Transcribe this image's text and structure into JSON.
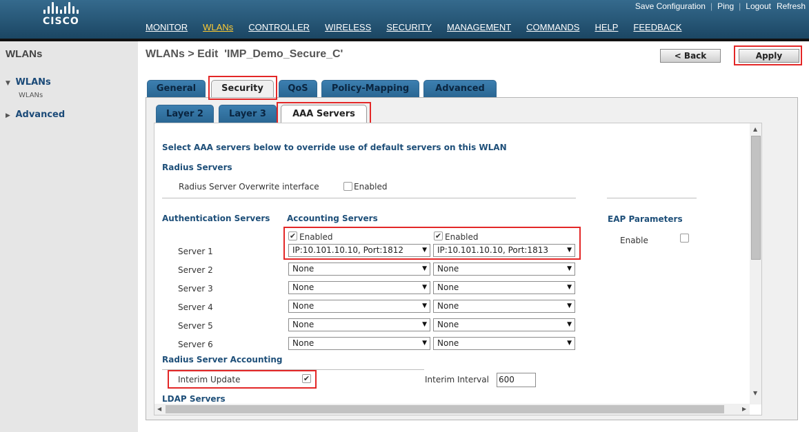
{
  "brand": {
    "name": "CISCO"
  },
  "utility_links": [
    {
      "name": "save-configuration-link",
      "label": "Save Configuration"
    },
    {
      "name": "ping-link",
      "label": "Ping"
    },
    {
      "name": "logout-link",
      "label": "Logout"
    },
    {
      "name": "refresh-link",
      "label": "Refresh"
    }
  ],
  "nav": [
    {
      "name": "nav-monitor",
      "label": "MONITOR"
    },
    {
      "name": "nav-wlans",
      "label": "WLANs",
      "active": true
    },
    {
      "name": "nav-controller",
      "label": "CONTROLLER"
    },
    {
      "name": "nav-wireless",
      "label": "WIRELESS"
    },
    {
      "name": "nav-security",
      "label": "SECURITY"
    },
    {
      "name": "nav-management",
      "label": "MANAGEMENT"
    },
    {
      "name": "nav-commands",
      "label": "COMMANDS"
    },
    {
      "name": "nav-help",
      "label": "HELP"
    },
    {
      "name": "nav-feedback",
      "label": "FEEDBACK"
    }
  ],
  "sidebar": {
    "title": "WLANs",
    "items": [
      {
        "label": "WLANs",
        "expanded": true,
        "icon": "triangle-down-icon",
        "children": [
          "WLANs"
        ]
      },
      {
        "label": "Advanced",
        "expanded": false,
        "icon": "triangle-right-icon"
      }
    ]
  },
  "page": {
    "title": "WLANs > Edit  'IMP_Demo_Secure_C'",
    "back_label": "< Back",
    "apply_label": "Apply"
  },
  "tabs": [
    {
      "label": "General"
    },
    {
      "label": "Security",
      "selected": true
    },
    {
      "label": "QoS"
    },
    {
      "label": "Policy-Mapping"
    },
    {
      "label": "Advanced"
    }
  ],
  "subtabs": [
    {
      "label": "Layer 2"
    },
    {
      "label": "Layer 3"
    },
    {
      "label": "AAA Servers",
      "selected": true
    }
  ],
  "aaa": {
    "intro": "Select AAA servers below to override use of default servers on this WLAN",
    "radius_heading": "Radius Servers",
    "overwrite_label": "Radius Server Overwrite interface",
    "overwrite_enabled_label": "Enabled",
    "overwrite_checked": false,
    "auth_heading": "Authentication Servers",
    "acct_heading": "Accounting Servers",
    "eap_heading": "EAP Parameters",
    "eap_enable_label": "Enable",
    "eap_checked": false,
    "auth_enabled_label": "Enabled",
    "auth_enabled_checked": true,
    "acct_enabled_label": "Enabled",
    "acct_enabled_checked": true,
    "servers": [
      {
        "label": "Server 1",
        "auth": "IP:10.101.10.10, Port:1812",
        "acct": "IP:10.101.10.10, Port:1813"
      },
      {
        "label": "Server 2",
        "auth": "None",
        "acct": "None"
      },
      {
        "label": "Server 3",
        "auth": "None",
        "acct": "None"
      },
      {
        "label": "Server 4",
        "auth": "None",
        "acct": "None"
      },
      {
        "label": "Server 5",
        "auth": "None",
        "acct": "None"
      },
      {
        "label": "Server 6",
        "auth": "None",
        "acct": "None"
      }
    ],
    "accounting_heading": "Radius Server Accounting",
    "interim_update_label": "Interim Update",
    "interim_update_checked": true,
    "interim_interval_label": "Interim Interval",
    "interim_interval_value": "600",
    "ldap_heading": "LDAP Servers"
  },
  "colors": {
    "header_blue": "#2a5a7c",
    "tab_blue": "#3575a4",
    "heading_blue": "#1e4f79",
    "highlight_red": "#e32626",
    "active_nav": "#ffcc33"
  }
}
